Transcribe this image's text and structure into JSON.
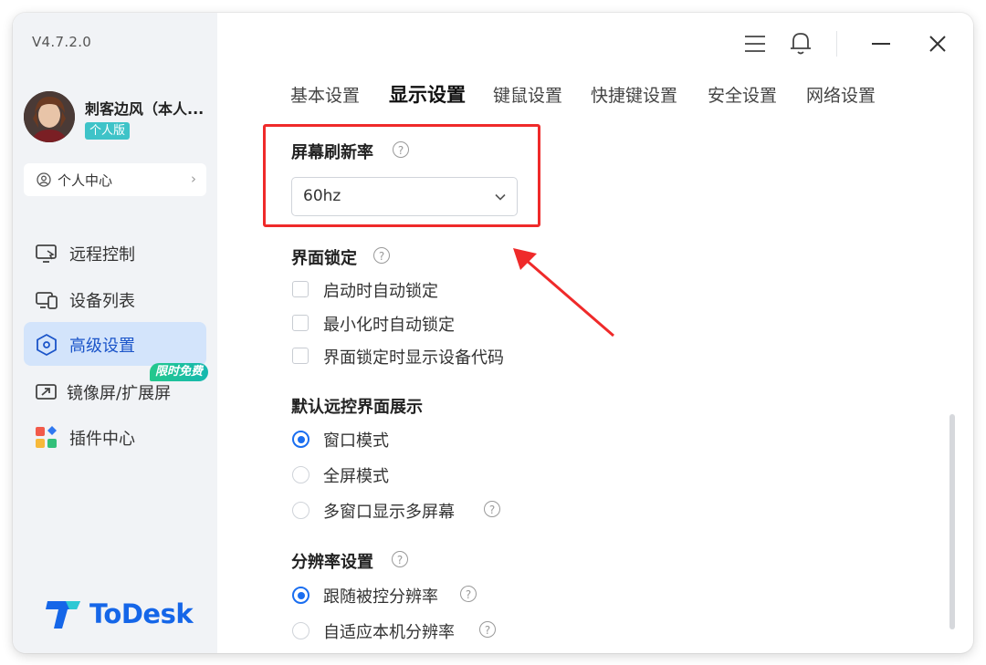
{
  "app": {
    "version": "V4.7.2.0",
    "brand": "ToDesk",
    "brand_color": "#1566e8"
  },
  "user": {
    "name": "刺客边风（本人...",
    "edition_badge": "个人版"
  },
  "personal_center": {
    "label": "个人中心",
    "chevron": "›"
  },
  "sidebar": {
    "items": [
      {
        "label": "远程控制",
        "icon": "remote-desktop-icon",
        "active": false
      },
      {
        "label": "设备列表",
        "icon": "device-list-icon",
        "active": false
      },
      {
        "label": "高级设置",
        "icon": "hexagon-settings-icon",
        "active": true
      },
      {
        "label": "镜像屏/扩展屏",
        "icon": "mirror-screen-icon",
        "active": false
      },
      {
        "label": "插件中心",
        "icon": "plugin-grid-icon",
        "active": false
      }
    ],
    "promo_badge": "限时免费"
  },
  "titlebar": {
    "icons": [
      "menu-icon",
      "bell-icon",
      "minimize-icon",
      "close-icon"
    ]
  },
  "tabs": [
    "基本设置",
    "显示设置",
    "键鼠设置",
    "快捷键设置",
    "安全设置",
    "网络设置"
  ],
  "active_tab": "显示设置",
  "refresh_rate": {
    "title": "屏幕刷新率",
    "help": "?",
    "value": "60hz"
  },
  "interface_lock": {
    "title": "界面锁定",
    "help": "?",
    "options": [
      {
        "label": "启动时自动锁定",
        "checked": false
      },
      {
        "label": "最小化时自动锁定",
        "checked": false
      },
      {
        "label": "界面锁定时显示设备代码",
        "checked": false
      }
    ]
  },
  "default_display": {
    "title": "默认远控界面展示",
    "options": [
      {
        "label": "窗口模式",
        "selected": true
      },
      {
        "label": "全屏模式",
        "selected": false
      },
      {
        "label": "多窗口显示多屏幕",
        "selected": false,
        "help": "?"
      }
    ]
  },
  "resolution": {
    "title": "分辨率设置",
    "help": "?",
    "options": [
      {
        "label": "跟随被控分辨率",
        "selected": true,
        "help": "?"
      },
      {
        "label": "自适应本机分辨率",
        "selected": false,
        "help": "?"
      }
    ]
  },
  "colors": {
    "accent": "#1a6ef0",
    "highlight": "#ef2a2a",
    "sidebar_bg": "#f1f3f6",
    "active_nav_bg": "#d3e4fb"
  }
}
